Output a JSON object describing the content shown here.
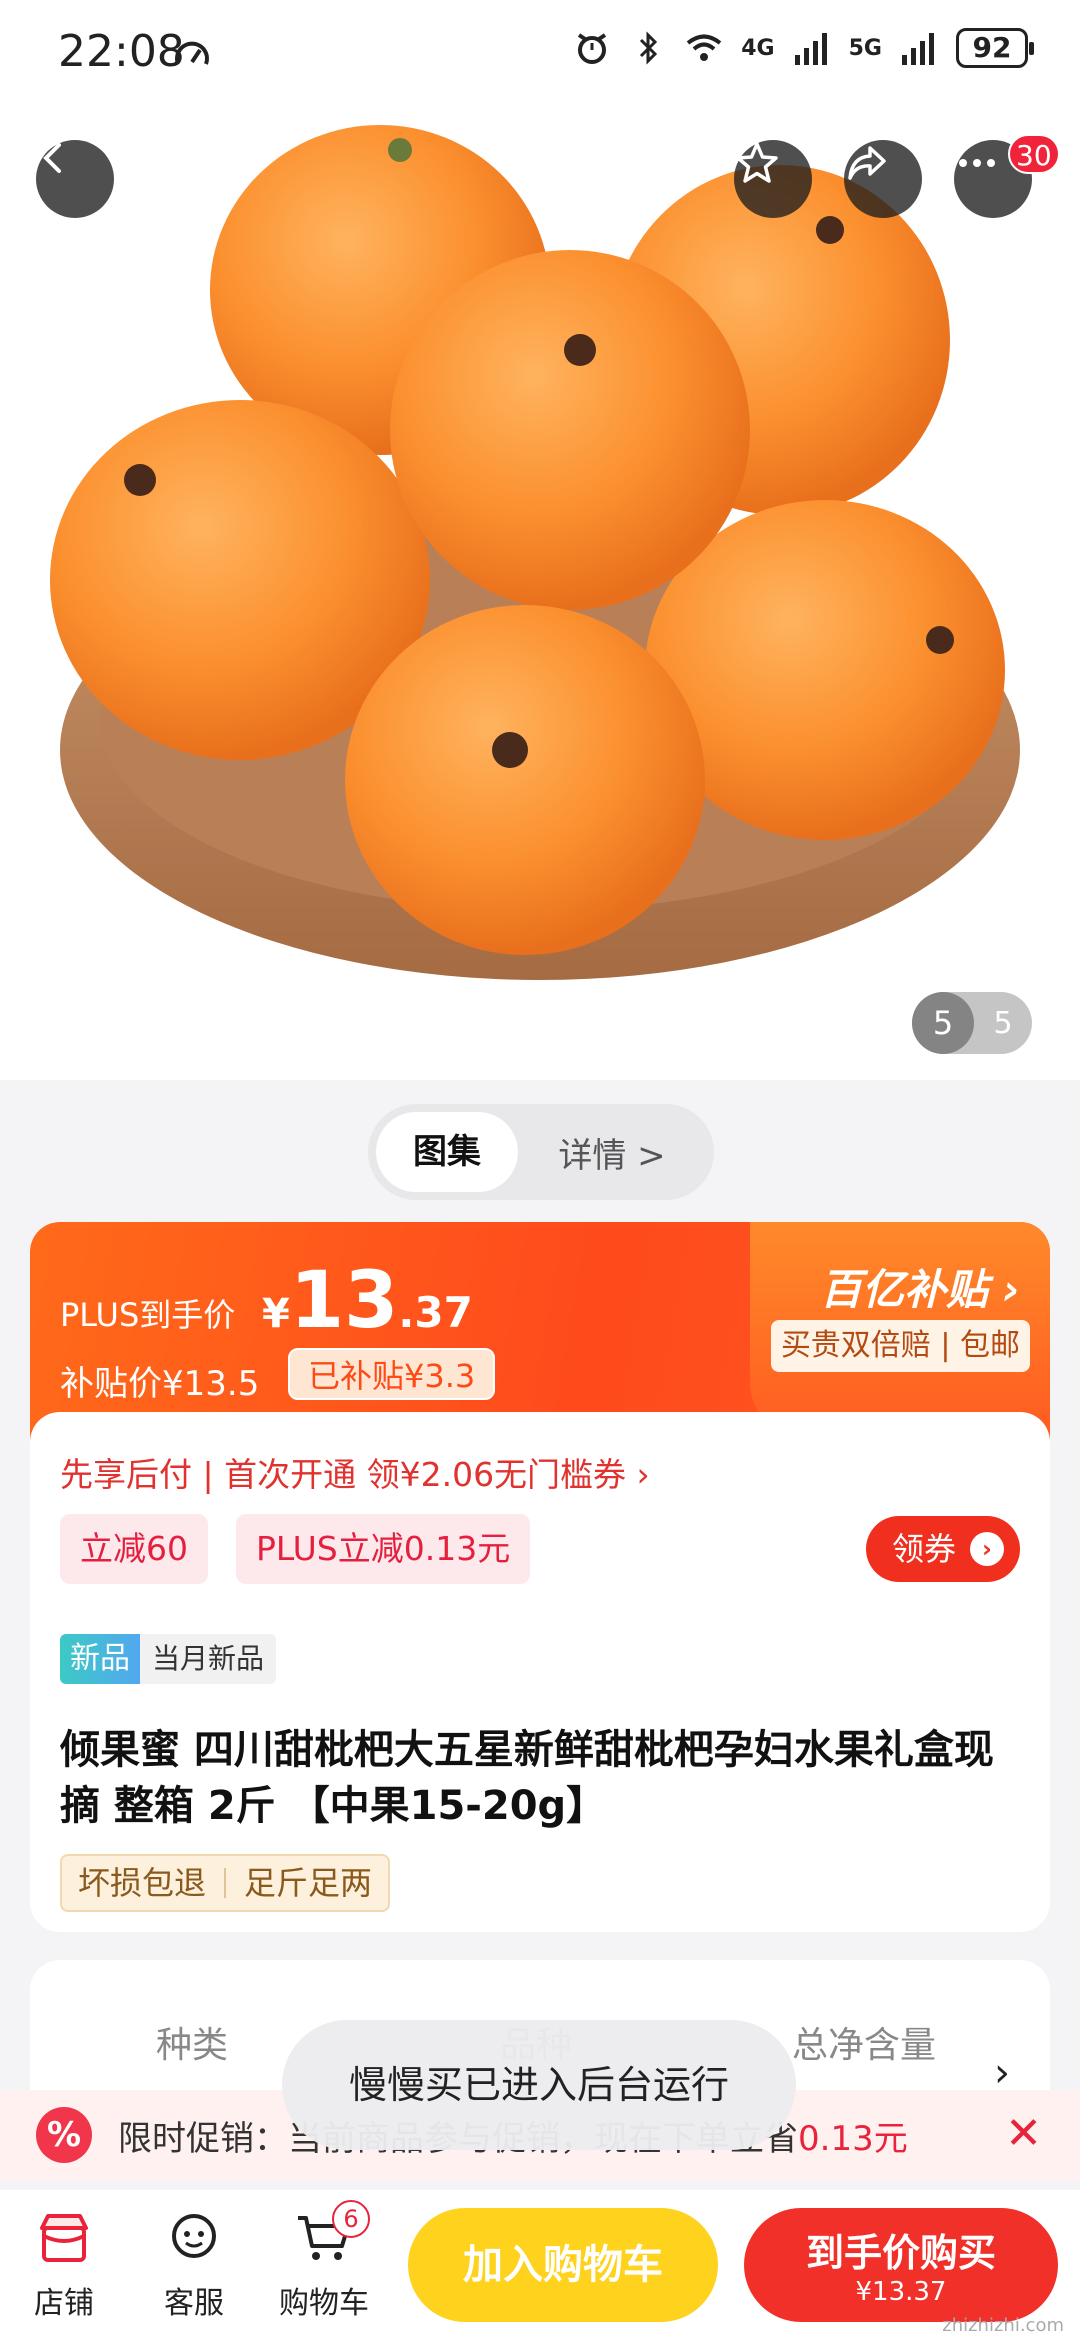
{
  "status_bar": {
    "time": "22:08",
    "battery": "92",
    "signal_1": "4G",
    "signal_2": "5G"
  },
  "hero": {
    "more_badge": "30",
    "pager_current": "5",
    "pager_total": "5"
  },
  "view_toggle": {
    "gallery": "图集",
    "details": "详情 >"
  },
  "price": {
    "plus_label": "PLUS到手价",
    "currency": "¥",
    "plus_int": "13",
    "plus_dec": ".37",
    "subsidy_label": "补贴价¥13.5",
    "subsidy_chip": "已补贴¥3.3",
    "brand": "百亿补贴",
    "brand_tags": "买贵双倍赔 | 包邮",
    "promo_line": "先享后付 | 首次开通 领¥2.06无门槛券 ›",
    "chip_1": "立减60",
    "chip_2": "PLUS立减0.13元",
    "coupon_button": "领券",
    "new_tag": "新品",
    "new_tag_text": "当月新品",
    "title": "倾果蜜 四川甜枇杷大五星新鲜甜枇杷孕妇水果礼盒现摘 整箱 2斤 【中果15-20g】",
    "guarantee_1": "坏损包退",
    "guarantee_2": "足斤足两"
  },
  "specs": {
    "item_1": "种类",
    "item_2": "品种",
    "item_3": "总净含量"
  },
  "toast": "慢慢买已进入后台运行",
  "promo_banner": {
    "label": "限时促销：",
    "text": "当前商品参与促销，现在下单立省",
    "amount": "0.13元"
  },
  "bottom": {
    "shop": "店铺",
    "service": "客服",
    "cart": "购物车",
    "cart_badge": "6",
    "add_to_cart": "加入购物车",
    "buy_label": "到手价购买",
    "buy_price": "¥13.37"
  },
  "watermark": "zhizhizhi.com",
  "colors": {
    "accent_orange": "#ff5a1f",
    "accent_red": "#f2302a",
    "cart_yellow": "#ffd21d"
  }
}
